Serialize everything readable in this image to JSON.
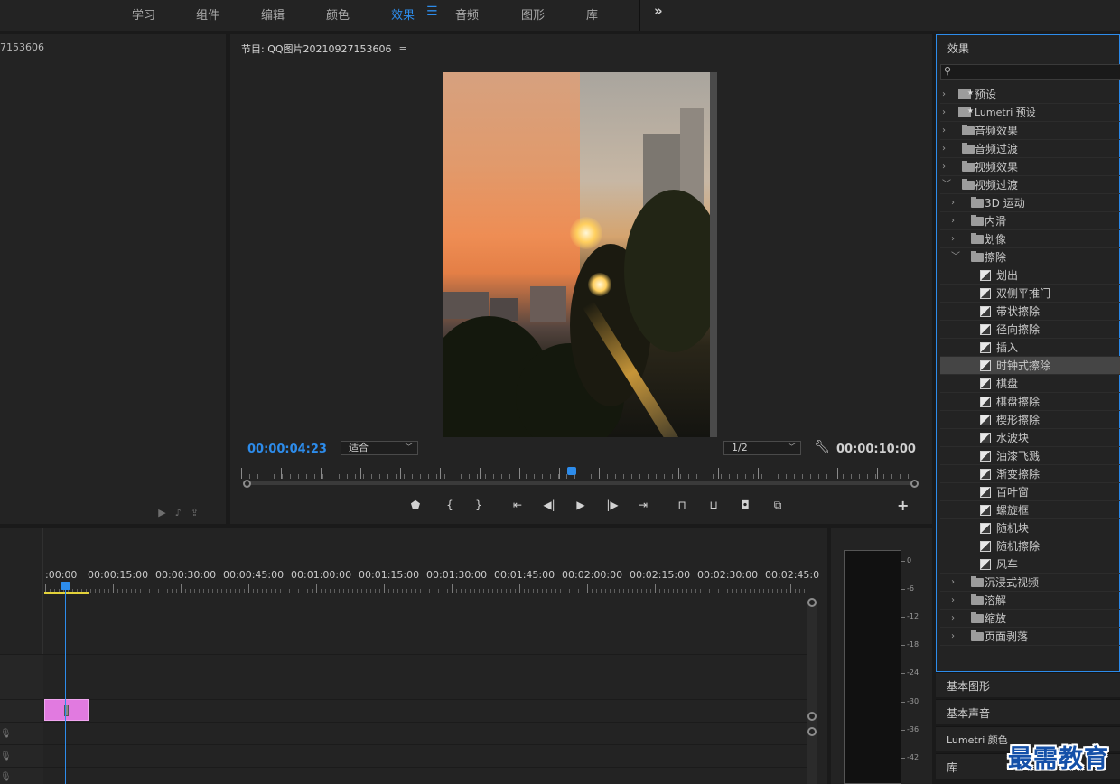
{
  "workspace_tabs": [
    "学习",
    "组件",
    "编辑",
    "颜色",
    "效果",
    "音频",
    "图形",
    "库"
  ],
  "active_tab": "效果",
  "overflow_icon": "chevrons-right-icon",
  "source_panel": {
    "title": "7153606"
  },
  "program_monitor": {
    "title": "节目: QQ图片20210927153606",
    "menu_icon": "hamburger-icon",
    "current_time": "00:00:04:23",
    "zoom_select": "适合",
    "resolution_select": "1/2",
    "duration": "00:00:10:00",
    "playhead_fraction": 0.49
  },
  "effects_panel": {
    "title": "效果",
    "search_placeholder": "",
    "tree": [
      {
        "label": "预设",
        "kind": "preset",
        "level": 0,
        "expanded": false
      },
      {
        "label": "Lumetri 预设",
        "kind": "preset",
        "level": 0,
        "expanded": false
      },
      {
        "label": "音频效果",
        "kind": "folder",
        "level": 0,
        "expanded": false
      },
      {
        "label": "音频过渡",
        "kind": "folder",
        "level": 0,
        "expanded": false
      },
      {
        "label": "视频效果",
        "kind": "folder",
        "level": 0,
        "expanded": false
      },
      {
        "label": "视频过渡",
        "kind": "folder",
        "level": 0,
        "expanded": true
      },
      {
        "label": "3D 运动",
        "kind": "folder",
        "level": 1,
        "expanded": false
      },
      {
        "label": "内滑",
        "kind": "folder",
        "level": 1,
        "expanded": false
      },
      {
        "label": "划像",
        "kind": "folder",
        "level": 1,
        "expanded": false
      },
      {
        "label": "擦除",
        "kind": "folder",
        "level": 1,
        "expanded": true
      },
      {
        "label": "划出",
        "kind": "effect",
        "level": 2
      },
      {
        "label": "双侧平推门",
        "kind": "effect",
        "level": 2
      },
      {
        "label": "带状擦除",
        "kind": "effect",
        "level": 2
      },
      {
        "label": "径向擦除",
        "kind": "effect",
        "level": 2
      },
      {
        "label": "插入",
        "kind": "effect",
        "level": 2
      },
      {
        "label": "时钟式擦除",
        "kind": "effect",
        "level": 2,
        "selected": true
      },
      {
        "label": "棋盘",
        "kind": "effect",
        "level": 2
      },
      {
        "label": "棋盘擦除",
        "kind": "effect",
        "level": 2
      },
      {
        "label": "楔形擦除",
        "kind": "effect",
        "level": 2
      },
      {
        "label": "水波块",
        "kind": "effect",
        "level": 2
      },
      {
        "label": "油漆飞溅",
        "kind": "effect",
        "level": 2
      },
      {
        "label": "渐变擦除",
        "kind": "effect",
        "level": 2
      },
      {
        "label": "百叶窗",
        "kind": "effect",
        "level": 2
      },
      {
        "label": "螺旋框",
        "kind": "effect",
        "level": 2
      },
      {
        "label": "随机块",
        "kind": "effect",
        "level": 2
      },
      {
        "label": "随机擦除",
        "kind": "effect",
        "level": 2
      },
      {
        "label": "风车",
        "kind": "effect",
        "level": 2
      },
      {
        "label": "沉浸式视频",
        "kind": "folder",
        "level": 1,
        "expanded": false
      },
      {
        "label": "溶解",
        "kind": "folder",
        "level": 1,
        "expanded": false
      },
      {
        "label": "缩放",
        "kind": "folder",
        "level": 1,
        "expanded": false
      },
      {
        "label": "页面剥落",
        "kind": "folder",
        "level": 1,
        "expanded": false
      }
    ]
  },
  "side_tabs": [
    "基本图形",
    "基本声音",
    "Lumetri 颜色",
    "库"
  ],
  "timeline": {
    "ruler_labels": [
      ":00:00",
      "00:00:15:00",
      "00:00:30:00",
      "00:00:45:00",
      "00:01:00:00",
      "00:01:15:00",
      "00:01:30:00",
      "00:01:45:00",
      "00:02:00:00",
      "00:02:15:00",
      "00:02:30:00",
      "00:02:45:0"
    ]
  },
  "audio_meter": {
    "scale": [
      "0",
      "-6",
      "-12",
      "-18",
      "-24",
      "-30",
      "-36",
      "-42"
    ]
  },
  "watermark": "最需教育",
  "colors": {
    "accent": "#2d8ceb",
    "clip": "#e17ae0",
    "workarea": "#e3d23a"
  }
}
